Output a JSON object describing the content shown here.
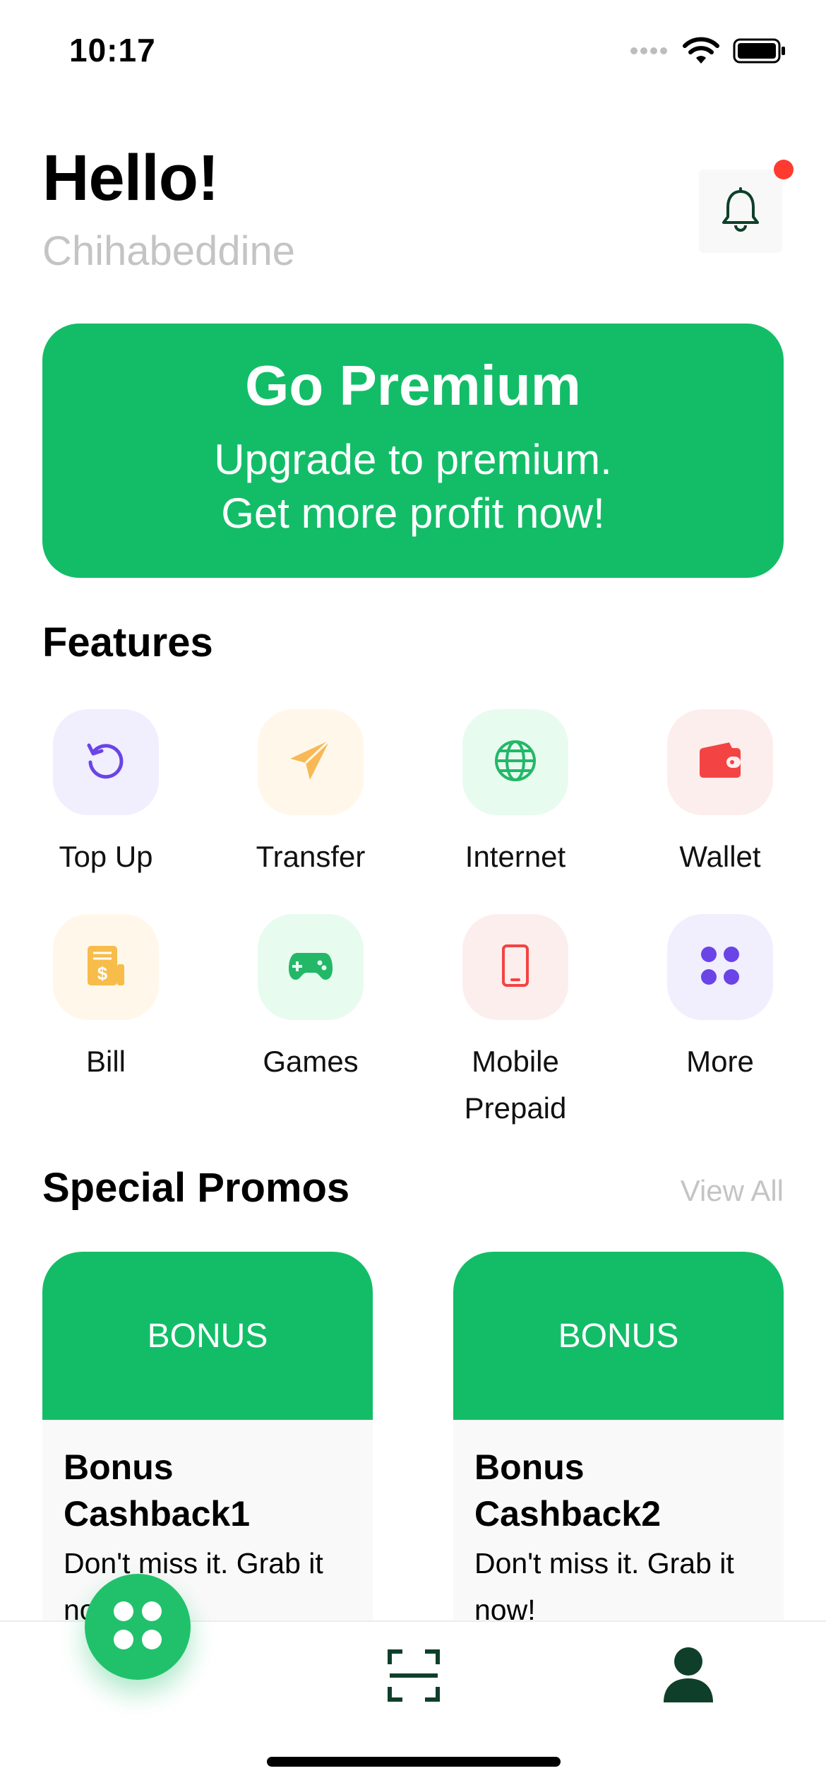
{
  "status_bar": {
    "time": "10:17"
  },
  "header": {
    "greeting": "Hello!",
    "username": "Chihabeddine"
  },
  "premium": {
    "title": "Go Premium",
    "line1": "Upgrade to premium.",
    "line2": "Get more profit now!",
    "color": "#13bd68"
  },
  "features": {
    "title": "Features",
    "items": [
      {
        "label": "Top Up",
        "icon": "refresh-icon",
        "tile_color": "#f1eefe",
        "icon_color": "#6a44e6"
      },
      {
        "label": "Transfer",
        "icon": "paper-plane-icon",
        "tile_color": "#fff8ea",
        "icon_color": "#f7b955"
      },
      {
        "label": "Internet",
        "icon": "globe-icon",
        "tile_color": "#e8fbef",
        "icon_color": "#22b868"
      },
      {
        "label": "Wallet",
        "icon": "wallet-icon",
        "tile_color": "#fdeeee",
        "icon_color": "#f44343"
      },
      {
        "label": "Bill",
        "icon": "bill-icon",
        "tile_color": "#fff8ea",
        "icon_color": "#f7bc4a"
      },
      {
        "label": "Games",
        "icon": "gamepad-icon",
        "tile_color": "#e8fbef",
        "icon_color": "#22b868"
      },
      {
        "label": "Mobile\nPrepaid",
        "line1": "Mobile",
        "line2": "Prepaid",
        "icon": "phone-icon",
        "tile_color": "#fdeeee",
        "icon_color": "#f44343"
      },
      {
        "label": "More",
        "icon": "grid-dots-icon",
        "tile_color": "#f1eefe",
        "icon_color": "#6a44e6"
      }
    ]
  },
  "promos": {
    "title": "Special Promos",
    "view_all": "View All",
    "cards": [
      {
        "badge": "BONUS",
        "title": "Bonus Cashback1",
        "desc": "Don't miss it. Grab it now!"
      },
      {
        "badge": "BONUS",
        "title": "Bonus Cashback2",
        "desc": "Don't miss it. Grab it now!"
      }
    ]
  },
  "bottom_nav": {
    "items": [
      {
        "icon": "grid-dots-icon"
      },
      {
        "icon": "scan-icon"
      },
      {
        "icon": "profile-icon"
      }
    ],
    "dark_color": "#0f3f2a"
  }
}
